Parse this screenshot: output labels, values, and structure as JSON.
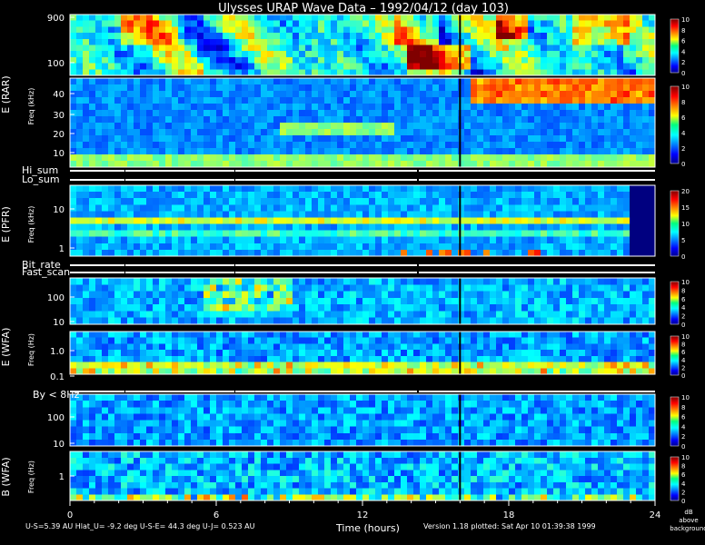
{
  "chart_data": {
    "type": "heatmap",
    "title": "Ulysses URAP Wave Data – 1992/04/12  (day 103)",
    "xlabel": "Time (hours)",
    "x_ticks": [
      "0",
      "6",
      "12",
      "18",
      "24"
    ],
    "xlim": [
      0,
      24
    ],
    "colorbar_unit": [
      "dB",
      "above",
      "background"
    ],
    "panels": [
      {
        "name": "rar-high",
        "ylabel": "E (RAR)",
        "yticks": [
          "900",
          "100"
        ],
        "scale": "log",
        "cb_ticks": [
          "10",
          "8",
          "6",
          "4",
          "2",
          "0"
        ],
        "cb_max": 10
      },
      {
        "name": "rar-low",
        "ylabel": "Freq (kHz)",
        "yticks": [
          "40",
          "30",
          "20",
          "10"
        ],
        "scale": "linear",
        "cb_ticks": [
          "10",
          "8",
          "6",
          "4",
          "2",
          "0"
        ],
        "cb_max": 10
      },
      {
        "name": "pfr",
        "ylabel": "E (PFR)",
        "sublabel": "Freq (kHz)",
        "yticks": [
          "10",
          "1"
        ],
        "scale": "log",
        "cb_ticks": [
          "20",
          "15",
          "10",
          "5",
          "0"
        ],
        "cb_max": 20
      },
      {
        "name": "wfa-e-high",
        "ylabel": "E (WFA)",
        "sublabel": "Freq (Hz)",
        "yticks": [
          "100",
          "10"
        ],
        "scale": "log",
        "cb_ticks": [
          "10",
          "8",
          "6",
          "4",
          "2",
          "0"
        ],
        "cb_max": 10
      },
      {
        "name": "wfa-e-low",
        "yticks": [
          "1.0",
          "0.1"
        ],
        "scale": "log",
        "cb_ticks": [
          "10",
          "8",
          "6",
          "4",
          "2",
          "0"
        ],
        "cb_max": 10
      },
      {
        "name": "wfa-b-high",
        "ylabel": "B (WFA)",
        "sublabel": "Freq (Hz)",
        "yticks": [
          "100",
          "10"
        ],
        "scale": "log",
        "cb_ticks": [
          "10",
          "8",
          "6",
          "4",
          "2",
          "0"
        ],
        "cb_max": 10
      },
      {
        "name": "wfa-b-low",
        "yticks": [
          "1"
        ],
        "scale": "log",
        "cb_ticks": [
          "10",
          "8",
          "6",
          "4",
          "2",
          "0"
        ],
        "cb_max": 10
      }
    ],
    "status_rows": [
      "Hi_sum",
      "Lo_sum",
      "Bit_rate",
      "Fast_scan",
      "By < 8Hz"
    ]
  },
  "footer": {
    "left": "U-S=5.39 AU  Hlat_U= -9.2 deg  U-S-E= 44.3 deg  U-J= 0.523 AU",
    "right": "Version 1.18 plotted: Sat Apr 10 01:39:38 1999"
  }
}
